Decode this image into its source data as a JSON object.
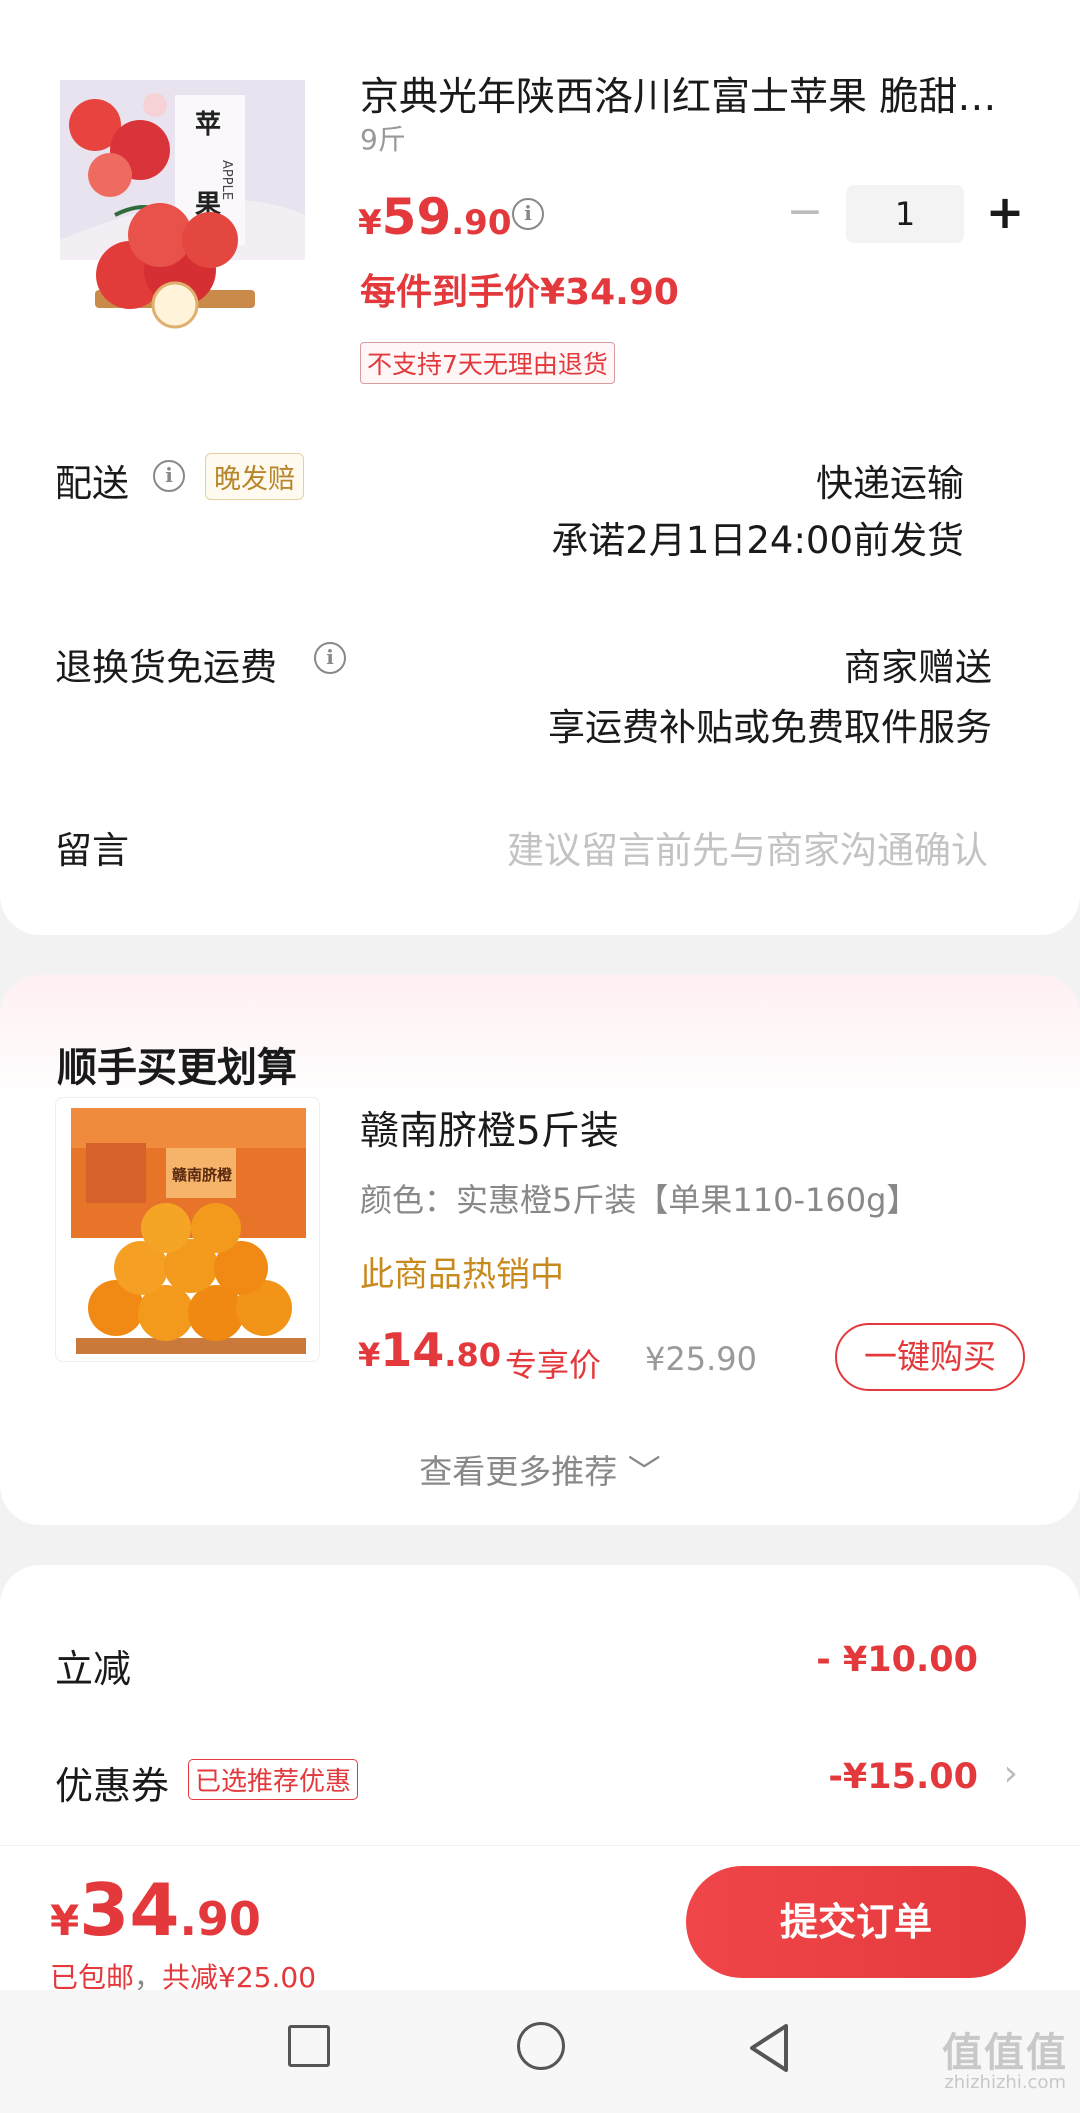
{
  "product": {
    "title": "京典光年陕西洛川红富士苹果 脆甜…",
    "spec": "9斤",
    "price_currency": "¥",
    "price_int": "59",
    "price_dec": ".90",
    "quantity": "1",
    "deal_price": "每件到手价¥34.90",
    "no_return_tag": "不支持7天无理由退货",
    "image_text_1": "苹",
    "image_text_2": "果",
    "image_text_3": "APPLE"
  },
  "shipping": {
    "label": "配送",
    "late_tag": "晚发赔",
    "method": "快递运输",
    "promise": "承诺2月1日24:00前发货"
  },
  "returns": {
    "label": "退换货免运费",
    "provider": "商家赠送",
    "desc": "享运费补贴或免费取件服务"
  },
  "message": {
    "label": "留言",
    "placeholder": "建议留言前先与商家沟通确认"
  },
  "upsell": {
    "title": "顺手买更划算",
    "item_title": "赣南脐橙5斤装",
    "item_spec": "颜色：实惠橙5斤装【单果110-160g】",
    "item_hot": "此商品热销中",
    "price_currency": "¥",
    "price_int": "14",
    "price_dec": ".80",
    "exclusive_label": "专享价",
    "original_price": "¥25.90",
    "buy_button": "一键购买",
    "more": "查看更多推荐 ﹀",
    "image_text": "赣南脐橙"
  },
  "discounts": {
    "instant_label": "立减",
    "instant_value": "- ¥10.00",
    "coupon_label": "优惠券",
    "coupon_tag": "已选推荐优惠",
    "coupon_value": "-¥15.00",
    "coupon_chevron": "›"
  },
  "footer": {
    "total_currency": "¥",
    "total_int": "34",
    "total_dec": ".90",
    "shipping_free": "已包邮",
    "separator": "，",
    "saved": "共减¥25.00",
    "submit": "提交订单"
  },
  "watermark": {
    "main": "值值值",
    "sub": "zhizhizhi.com"
  },
  "colors": {
    "accent": "#e4393c",
    "gold": "#c98a1d"
  }
}
